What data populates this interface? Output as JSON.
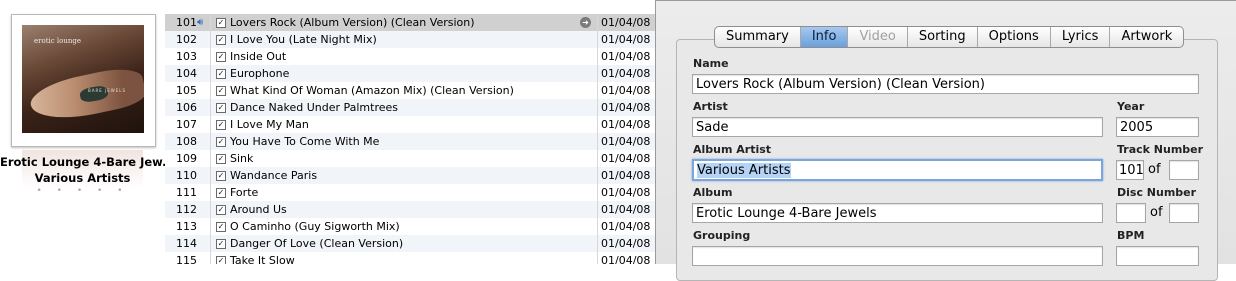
{
  "album": {
    "cover_title": "erotic lounge",
    "cover_subtitle": "BARE JEWELS",
    "name": "Erotic Lounge 4-Bare Jew...",
    "artist": "Various Artists",
    "rating": "• • • • •"
  },
  "tracks": [
    {
      "num": "101",
      "name": "Lovers Rock (Album Version) (Clean Version)",
      "date": "01/04/08",
      "playing": true
    },
    {
      "num": "102",
      "name": "I Love You (Late Night Mix)",
      "date": "01/04/08"
    },
    {
      "num": "103",
      "name": "Inside Out",
      "date": "01/04/08"
    },
    {
      "num": "104",
      "name": "Europhone",
      "date": "01/04/08"
    },
    {
      "num": "105",
      "name": "What Kind Of Woman (Amazon Mix) (Clean Version)",
      "date": "01/04/08"
    },
    {
      "num": "106",
      "name": "Dance Naked Under Palmtrees",
      "date": "01/04/08"
    },
    {
      "num": "107",
      "name": "I Love My Man",
      "date": "01/04/08"
    },
    {
      "num": "108",
      "name": "You Have To Come With Me",
      "date": "01/04/08"
    },
    {
      "num": "109",
      "name": "Sink",
      "date": "01/04/08"
    },
    {
      "num": "110",
      "name": "Wandance Paris",
      "date": "01/04/08"
    },
    {
      "num": "111",
      "name": "Forte",
      "date": "01/04/08"
    },
    {
      "num": "112",
      "name": "Around Us",
      "date": "01/04/08"
    },
    {
      "num": "113",
      "name": "O Caminho (Guy Sigworth Mix)",
      "date": "01/04/08"
    },
    {
      "num": "114",
      "name": "Danger Of Love (Clean Version)",
      "date": "01/04/08"
    },
    {
      "num": "115",
      "name": "Take It Slow",
      "date": "01/04/08"
    }
  ],
  "tabs": [
    "Summary",
    "Info",
    "Video",
    "Sorting",
    "Options",
    "Lyrics",
    "Artwork"
  ],
  "info": {
    "name_label": "Name",
    "name": "Lovers Rock (Album Version) (Clean Version)",
    "artist_label": "Artist",
    "artist": "Sade",
    "year_label": "Year",
    "year": "2005",
    "album_artist_label": "Album Artist",
    "album_artist": "Various Artists",
    "track_number_label": "Track Number",
    "track_number": "101",
    "track_total": "",
    "of_label": "of",
    "album_label": "Album",
    "album": "Erotic Lounge 4-Bare Jewels",
    "disc_number_label": "Disc Number",
    "disc_number": "",
    "disc_total": "",
    "grouping_label": "Grouping",
    "grouping": "",
    "bpm_label": "BPM",
    "bpm": ""
  },
  "colors": {
    "selected_row": "#d0d0d0",
    "active_tab": "#6aa0dc",
    "focus_ring": "#7aa6dd"
  }
}
